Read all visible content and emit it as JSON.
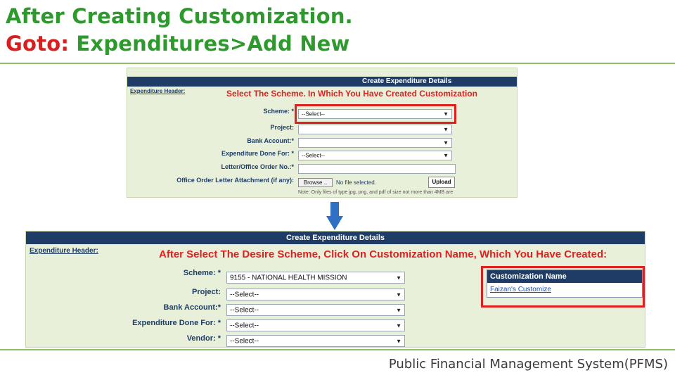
{
  "slide": {
    "title_line1": "After Creating Customization.",
    "title_line2_prefix": "Goto:",
    "title_line2_rest": " Expenditures>Add New",
    "footer": "Public Financial Management System(PFMS)",
    "colors": {
      "title_green": "#2e9a2e",
      "goto_red": "#d81e1e",
      "rule_green": "#8cc063",
      "header_navy": "#1e3c66",
      "highlight_red": "#e02020"
    }
  },
  "screen1": {
    "header": "Create Expenditure Details",
    "section_label": "Expenditure Header:",
    "instruction": "Select The Scheme. In Which You Have Created Customization",
    "fields": {
      "scheme": {
        "label": "Scheme: *",
        "value": "--Select--"
      },
      "project": {
        "label": "Project:",
        "value": ""
      },
      "bank_account": {
        "label": "Bank Account:*",
        "value": ""
      },
      "expenditure_done_for": {
        "label": "Expenditure Done For: *",
        "value": "--Select--"
      },
      "letter_no": {
        "label": "Letter/Office Order No.:*",
        "value": ""
      },
      "attachment": {
        "label": "Office Order Letter Attachment (if any):",
        "browse_label": "Browse ..",
        "file_status": "No file selected.",
        "upload_label": "Upload"
      }
    },
    "note": "Note: Only files of type jpg, png, and pdf of size not more than 4MB are"
  },
  "arrow_icon": "arrow-down-icon",
  "screen2": {
    "header": "Create Expenditure Details",
    "section_label": "Expenditure Header:",
    "instruction": "After Select The Desire Scheme, Click On Customization Name, Which You Have Created:",
    "fields": {
      "scheme": {
        "label": "Scheme: *",
        "value": "9155 - NATIONAL HEALTH MISSION"
      },
      "project": {
        "label": "Project:",
        "value": "--Select--"
      },
      "bank_account": {
        "label": "Bank Account:*",
        "value": "--Select--"
      },
      "expenditure_done_for": {
        "label": "Expenditure Done For: *",
        "value": "--Select--"
      },
      "vendor": {
        "label": "Vendor: *",
        "value": "--Select--"
      }
    },
    "customization": {
      "header": "Customization Name",
      "link": "Faizan's Customize"
    }
  }
}
